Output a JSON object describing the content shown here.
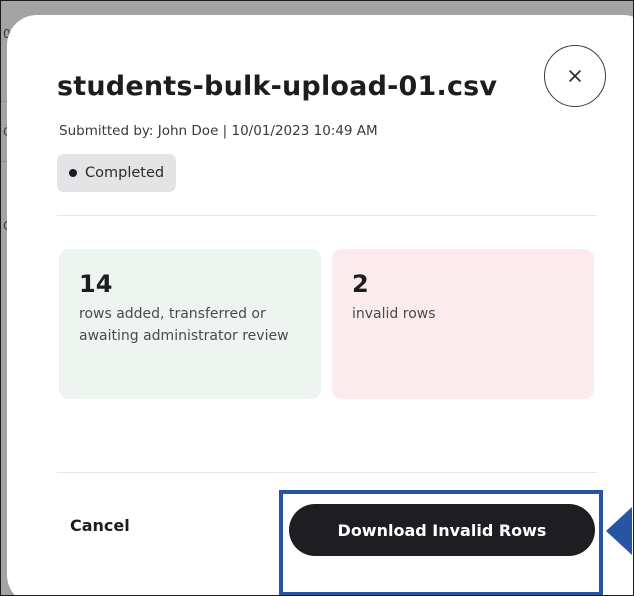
{
  "background": {
    "fragments": [
      "0",
      "C",
      "C"
    ]
  },
  "dialog": {
    "title": "students-bulk-upload-01.csv",
    "subtitle": "Submitted by: John Doe | 10/01/2023 10:49 AM",
    "status": "Completed",
    "close_icon": "close-icon"
  },
  "summary": {
    "success": {
      "count": "14",
      "description": "rows added, transferred or awaiting administrator review"
    },
    "invalid": {
      "count": "2",
      "description": "invalid rows"
    }
  },
  "actions": {
    "cancel_label": "Cancel",
    "download_label": "Download Invalid Rows"
  },
  "colors": {
    "highlight": "#2754a3",
    "primary_button": "#1e1e22",
    "success_card": "#eef5f0",
    "invalid_card": "#fbebed",
    "badge": "#e4e4e6"
  }
}
